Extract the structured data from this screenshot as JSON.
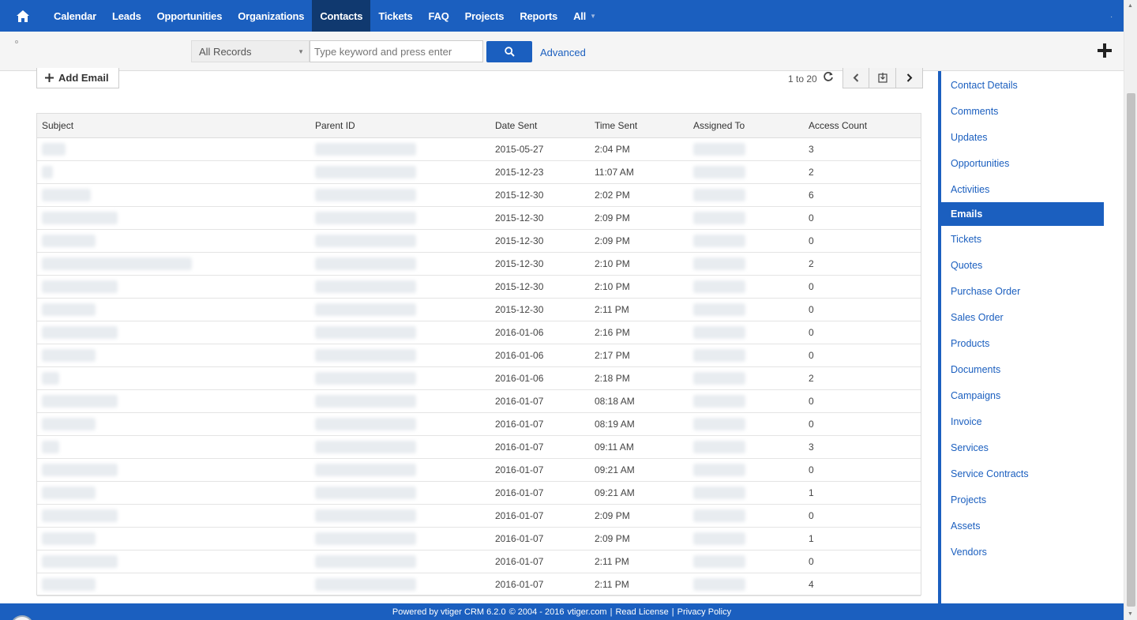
{
  "nav": {
    "items": [
      {
        "label": "Calendar",
        "active": false
      },
      {
        "label": "Leads",
        "active": false
      },
      {
        "label": "Opportunities",
        "active": false
      },
      {
        "label": "Organizations",
        "active": false
      },
      {
        "label": "Contacts",
        "active": true
      },
      {
        "label": "Tickets",
        "active": false
      },
      {
        "label": "FAQ",
        "active": false
      },
      {
        "label": "Projects",
        "active": false
      },
      {
        "label": "Reports",
        "active": false
      }
    ],
    "all_label": "All",
    "right_marker": "."
  },
  "search": {
    "records_value": "All Records",
    "placeholder": "Type keyword and press enter",
    "advanced_label": "Advanced"
  },
  "toolbar": {
    "add_email_label": "Add Email",
    "pager_text": "1 to 20"
  },
  "table": {
    "headers": [
      "Subject",
      "Parent ID",
      "Date Sent",
      "Time Sent",
      "Assigned To",
      "Access Count"
    ],
    "rows": [
      {
        "subject_w": 30,
        "date": "2015-05-27",
        "time": "2:04 PM",
        "count": "3"
      },
      {
        "subject_w": 14,
        "date": "2015-12-23",
        "time": "11:07 AM",
        "count": "2"
      },
      {
        "subject_w": 62,
        "date": "2015-12-30",
        "time": "2:02 PM",
        "count": "6"
      },
      {
        "subject_w": 96,
        "date": "2015-12-30",
        "time": "2:09 PM",
        "count": "0"
      },
      {
        "subject_w": 68,
        "date": "2015-12-30",
        "time": "2:09 PM",
        "count": "0"
      },
      {
        "subject_w": 190,
        "date": "2015-12-30",
        "time": "2:10 PM",
        "count": "2"
      },
      {
        "subject_w": 96,
        "date": "2015-12-30",
        "time": "2:10 PM",
        "count": "0"
      },
      {
        "subject_w": 68,
        "date": "2015-12-30",
        "time": "2:11 PM",
        "count": "0"
      },
      {
        "subject_w": 96,
        "date": "2016-01-06",
        "time": "2:16 PM",
        "count": "0"
      },
      {
        "subject_w": 68,
        "date": "2016-01-06",
        "time": "2:17 PM",
        "count": "0"
      },
      {
        "subject_w": 22,
        "date": "2016-01-06",
        "time": "2:18 PM",
        "count": "2"
      },
      {
        "subject_w": 96,
        "date": "2016-01-07",
        "time": "08:18 AM",
        "count": "0"
      },
      {
        "subject_w": 68,
        "date": "2016-01-07",
        "time": "08:19 AM",
        "count": "0"
      },
      {
        "subject_w": 22,
        "date": "2016-01-07",
        "time": "09:11 AM",
        "count": "3"
      },
      {
        "subject_w": 96,
        "date": "2016-01-07",
        "time": "09:21 AM",
        "count": "0"
      },
      {
        "subject_w": 68,
        "date": "2016-01-07",
        "time": "09:21 AM",
        "count": "1"
      },
      {
        "subject_w": 96,
        "date": "2016-01-07",
        "time": "2:09 PM",
        "count": "0"
      },
      {
        "subject_w": 68,
        "date": "2016-01-07",
        "time": "2:09 PM",
        "count": "1"
      },
      {
        "subject_w": 96,
        "date": "2016-01-07",
        "time": "2:11 PM",
        "count": "0"
      },
      {
        "subject_w": 68,
        "date": "2016-01-07",
        "time": "2:11 PM",
        "count": "4"
      }
    ]
  },
  "sidebar": {
    "items": [
      {
        "label": "Contact Details",
        "active": false
      },
      {
        "label": "Comments",
        "active": false
      },
      {
        "label": "Updates",
        "active": false
      },
      {
        "label": "Opportunities",
        "active": false
      },
      {
        "label": "Activities",
        "active": false
      },
      {
        "label": "Emails",
        "active": true
      },
      {
        "label": "Tickets",
        "active": false
      },
      {
        "label": "Quotes",
        "active": false
      },
      {
        "label": "Purchase Order",
        "active": false
      },
      {
        "label": "Sales Order",
        "active": false
      },
      {
        "label": "Products",
        "active": false
      },
      {
        "label": "Documents",
        "active": false
      },
      {
        "label": "Campaigns",
        "active": false
      },
      {
        "label": "Invoice",
        "active": false
      },
      {
        "label": "Services",
        "active": false
      },
      {
        "label": "Service Contracts",
        "active": false
      },
      {
        "label": "Projects",
        "active": false
      },
      {
        "label": "Assets",
        "active": false
      },
      {
        "label": "Vendors",
        "active": false
      }
    ]
  },
  "footer": {
    "powered": "Powered by vtiger CRM 6.2.0",
    "copyright": "© 2004 - 2016",
    "site": "vtiger.com",
    "sep1": "|",
    "license": "Read License",
    "sep2": "|",
    "privacy": "Privacy Policy"
  },
  "colors": {
    "brand_blue": "#1b5fbf",
    "active_nav": "#10396f"
  }
}
